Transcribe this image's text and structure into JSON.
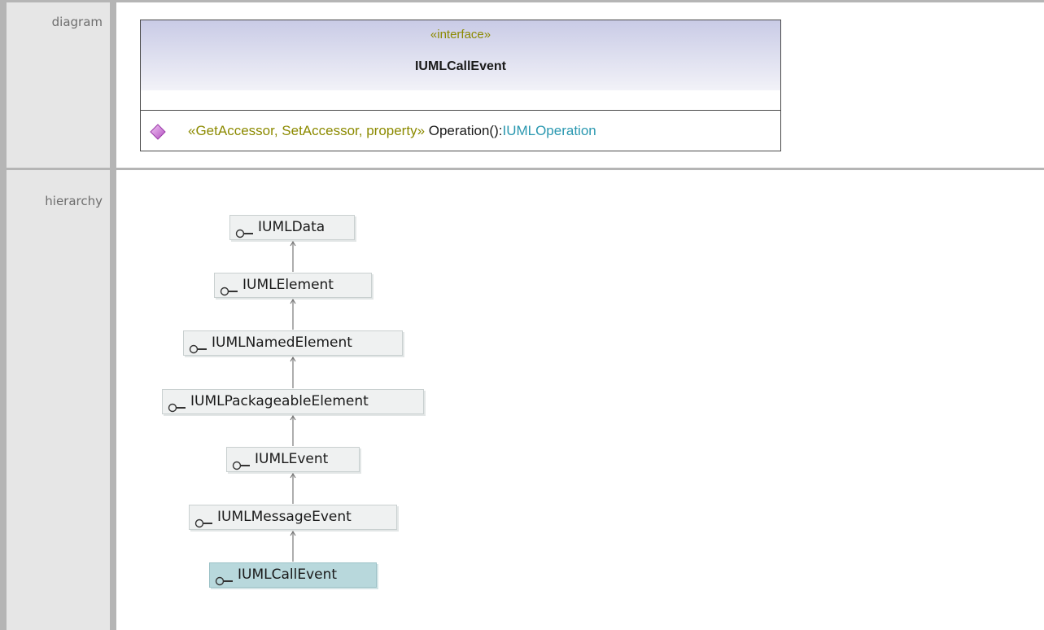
{
  "rows": [
    {
      "label": "diagram"
    },
    {
      "label": "hierarchy"
    }
  ],
  "interface": {
    "stereotype": "«interface»",
    "name": "IUMLCallEvent",
    "operation": {
      "icon": "operation-diamond-icon",
      "stereotype": "«GetAccessor, SetAccessor, property»",
      "signature": " Operation():",
      "return_type": "IUMLOperation"
    }
  },
  "hierarchy": [
    {
      "name": "IUMLData",
      "icon": "interface-lollipop-icon",
      "current": false
    },
    {
      "name": "IUMLElement",
      "icon": "interface-lollipop-icon",
      "current": false
    },
    {
      "name": "IUMLNamedElement",
      "icon": "interface-lollipop-icon",
      "current": false
    },
    {
      "name": "IUMLPackageableElement",
      "icon": "interface-lollipop-icon",
      "current": false
    },
    {
      "name": "IUMLEvent",
      "icon": "interface-lollipop-icon",
      "current": false
    },
    {
      "name": "IUMLMessageEvent",
      "icon": "interface-lollipop-icon",
      "current": false
    },
    {
      "name": "IUMLCallEvent",
      "icon": "interface-lollipop-icon",
      "current": true
    }
  ],
  "colors": {
    "stereotype": "#8c8a00",
    "return_type": "#2a98b0",
    "current_node": "#b8d8dc",
    "node": "#eff1f1"
  }
}
